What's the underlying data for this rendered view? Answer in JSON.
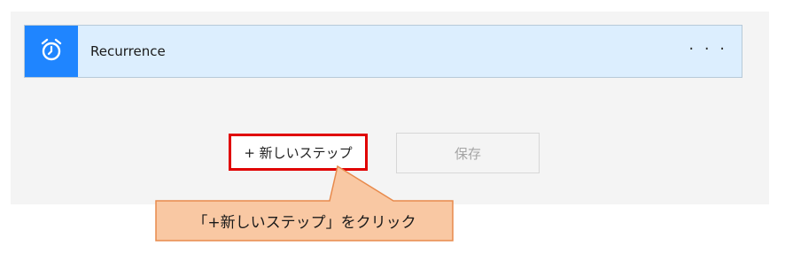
{
  "trigger": {
    "icon": "alarm-clock-icon",
    "title": "Recurrence",
    "more": "· · ·"
  },
  "actions": {
    "new_step_label": "+ 新しいステップ",
    "save_label": "保存"
  },
  "callout": {
    "text": "「+新しいステップ」をクリック"
  },
  "colors": {
    "accent": "#1f85ff",
    "card_bg": "#dceefe",
    "highlight_border": "#e00000",
    "callout_fill": "#f9c8a3",
    "callout_border": "#e88a4c"
  }
}
